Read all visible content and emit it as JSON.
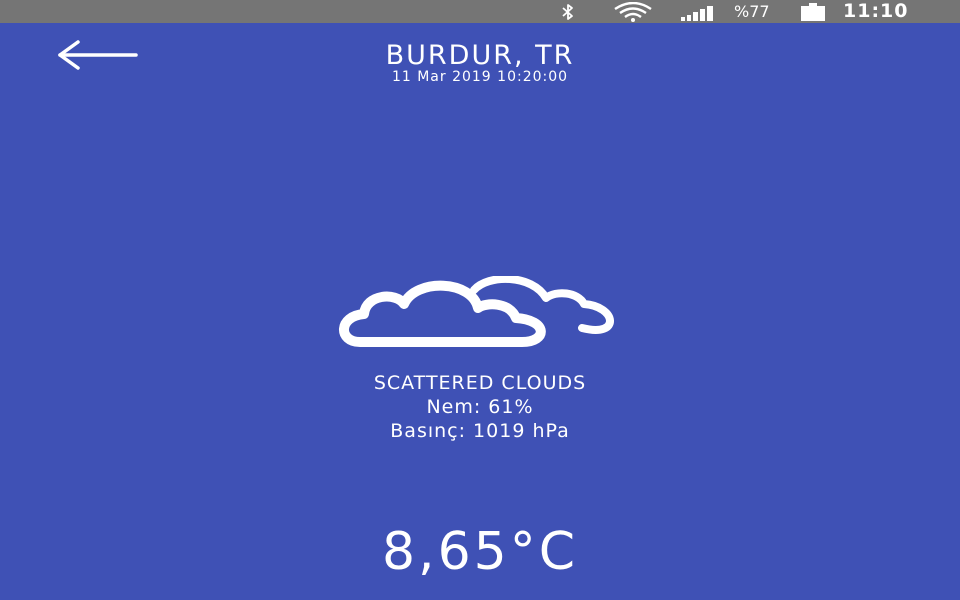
{
  "status_bar": {
    "battery_text": "%77",
    "time": "11:10",
    "icons": [
      "bluetooth-icon",
      "wifi-icon",
      "signal-icon",
      "battery-icon"
    ]
  },
  "header": {
    "back_icon": "arrow-left-icon",
    "city": "BURDUR, TR",
    "datetime": "11 Mar 2019 10:20:00"
  },
  "weather": {
    "icon": "scattered-clouds-icon",
    "description": "SCATTERED CLOUDS",
    "humidity": "Nem: 61%",
    "pressure": "Basınç: 1019 hPa",
    "temperature": "8,65°C"
  },
  "colors": {
    "background": "#3f51b5",
    "status_bar": "#757575",
    "foreground": "#ffffff"
  }
}
